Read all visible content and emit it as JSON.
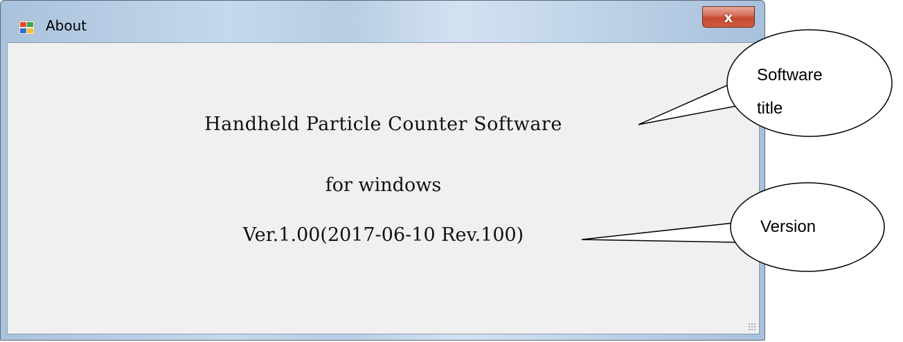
{
  "window": {
    "title": "About",
    "close_label": "x"
  },
  "content": {
    "software_title": "Handheld Particle Counter Software",
    "subtitle": "for windows",
    "version": "Ver.1.00(2017-06-10 Rev.100)"
  },
  "callouts": {
    "software_title_line1": "Software",
    "software_title_line2": "title",
    "version": "Version"
  },
  "icons": {
    "app": "app-window-icon",
    "close": "close-icon",
    "grip": "resize-grip-icon"
  },
  "colors": {
    "client_bg": "#f0f0f0",
    "close_button": "#c44a30",
    "titlebar": "#c5d8ec"
  }
}
